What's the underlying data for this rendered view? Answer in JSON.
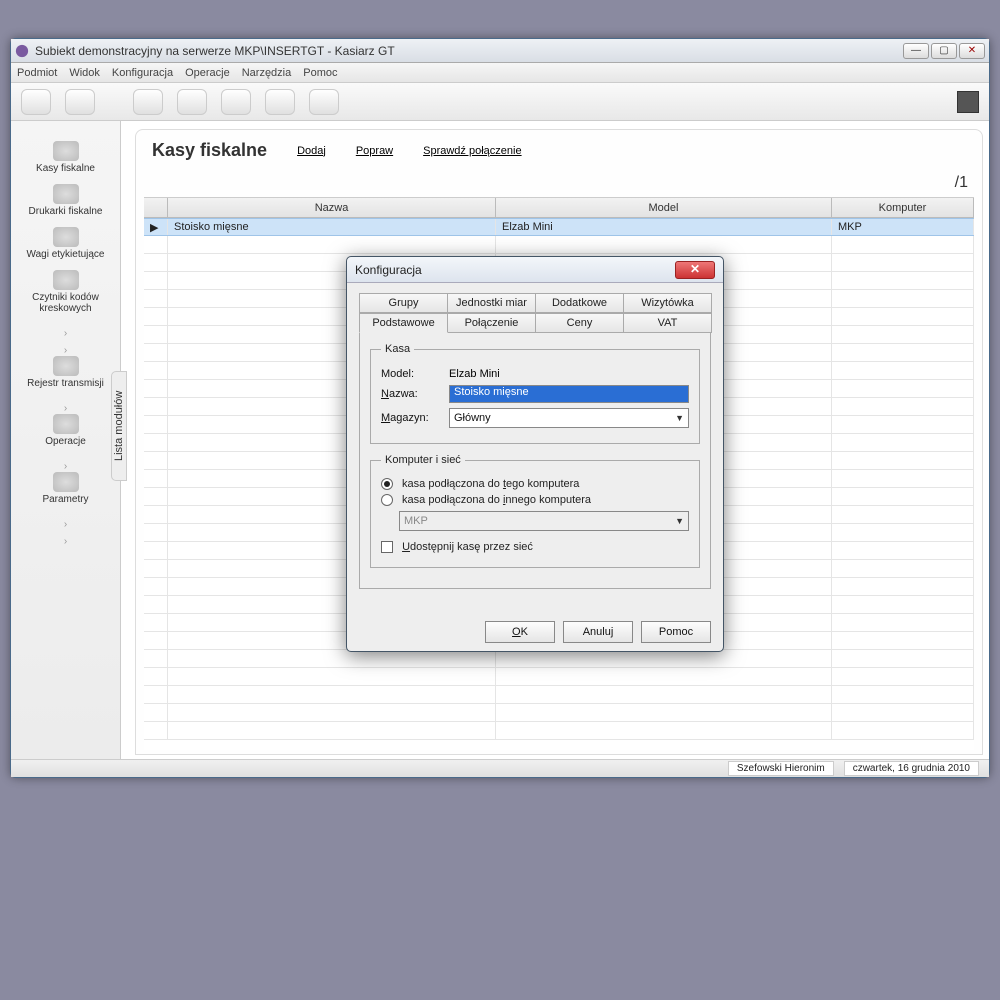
{
  "window": {
    "title": "Subiekt demonstracyjny na serwerze MKP\\INSERTGT - Kasiarz GT"
  },
  "menu": [
    "Podmiot",
    "Widok",
    "Konfiguracja",
    "Operacje",
    "Narzędzia",
    "Pomoc"
  ],
  "sidebar": {
    "items": [
      {
        "label": "Kasy fiskalne"
      },
      {
        "label": "Drukarki fiskalne"
      },
      {
        "label": "Wagi etykietujące"
      },
      {
        "label": "Czytniki kodów kreskowych"
      },
      {
        "label": "Rejestr transmisji"
      },
      {
        "label": "Operacje"
      },
      {
        "label": "Parametry"
      }
    ],
    "vertical_tab": "Lista modułów"
  },
  "main": {
    "title": "Kasy fiskalne",
    "actions": [
      "Dodaj",
      "Popraw",
      "Sprawdź połączenie"
    ],
    "pager": "/1",
    "columns": [
      "Nazwa",
      "Model",
      "Komputer"
    ],
    "rows": [
      {
        "nazwa": "Stoisko mięsne",
        "model": "Elzab Mini",
        "komputer": "MKP"
      }
    ]
  },
  "status": {
    "user": "Szefowski Hieronim",
    "date": "czwartek, 16 grudnia 2010"
  },
  "dialog": {
    "title": "Konfiguracja",
    "tabs_top": [
      "Grupy",
      "Jednostki miar",
      "Dodatkowe",
      "Wizytówka"
    ],
    "tabs_bottom": [
      "Podstawowe",
      "Połączenie",
      "Ceny",
      "VAT"
    ],
    "active_tab": "Podstawowe",
    "group1": {
      "legend": "Kasa",
      "model_label": "Model:",
      "model_value": "Elzab Mini",
      "nazwa_label": "Nazwa:",
      "nazwa_value": "Stoisko mięsne",
      "magazyn_label": "Magazyn:",
      "magazyn_value": "Główny"
    },
    "group2": {
      "legend": "Komputer i sieć",
      "opt1": "kasa podłączona do tego komputera",
      "opt2": "kasa podłączona do innego komputera",
      "combo_value": "MKP",
      "check_label": "Udostępnij kasę przez sieć"
    },
    "buttons": {
      "ok": "OK",
      "cancel": "Anuluj",
      "help": "Pomoc"
    }
  }
}
